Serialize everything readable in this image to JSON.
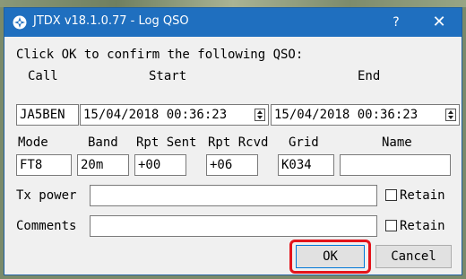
{
  "window": {
    "title": "JTDX v18.1.0.77 - Log QSO",
    "help_label": "?",
    "close_label": "✕",
    "icon": "jtdx-app-icon"
  },
  "dialog": {
    "prompt": "Click OK to confirm the following QSO:",
    "headers": {
      "call": "Call",
      "start": "Start",
      "end": "End"
    },
    "call": "JA5BEN",
    "start": "15/04/2018 00:36:23",
    "end": "15/04/2018 00:36:23",
    "labels": {
      "mode": "Mode",
      "band": "Band",
      "rpt_sent": "Rpt Sent",
      "rpt_rcvd": "Rpt Rcvd",
      "grid": "Grid",
      "name": "Name"
    },
    "mode": "FT8",
    "band": "20m",
    "rpt_sent": "+00",
    "rpt_rcvd": "+06",
    "grid": "K034",
    "name": "",
    "tx_power_label": "Tx power",
    "tx_power": "",
    "comments_label": "Comments",
    "comments": "",
    "retain_label": "Retain",
    "retain_tx_power": false,
    "retain_comments": false,
    "ok_label": "OK",
    "cancel_label": "Cancel"
  },
  "colors": {
    "titlebar": "#1f6fbf",
    "highlight": "#e3141b",
    "ok_focus": "#0078d7"
  }
}
